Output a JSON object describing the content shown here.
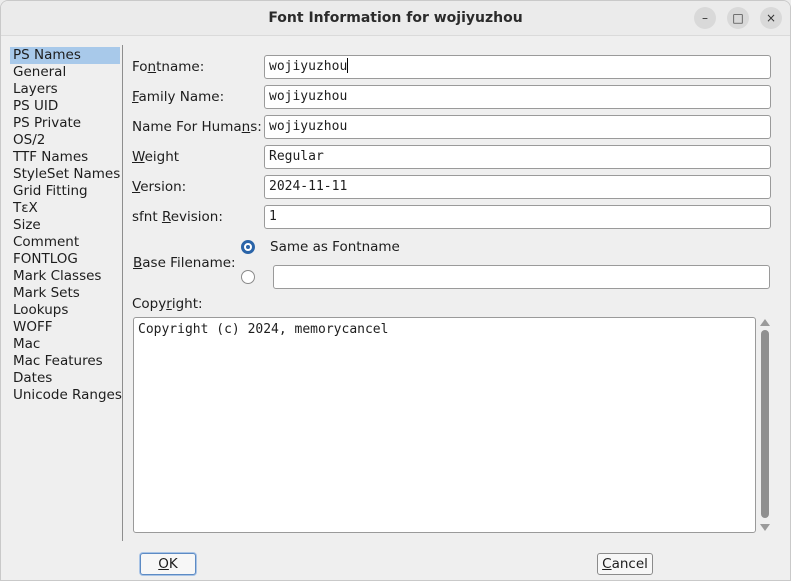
{
  "window": {
    "title": "Font Information for wojiyuzhou",
    "controls": {
      "minimize": "–",
      "maximize": "□",
      "close": "×"
    }
  },
  "sidebar": {
    "items": [
      "PS Names",
      "General",
      "Layers",
      "PS UID",
      "PS Private",
      "OS/2",
      "TTF Names",
      "StyleSet Names",
      "Grid Fitting",
      "TεX",
      "Size",
      "Comment",
      "FONTLOG",
      "Mark Classes",
      "Mark Sets",
      "Lookups",
      "WOFF",
      "Mac",
      "Mac Features",
      "Dates",
      "Unicode Ranges"
    ],
    "selected": "PS Names"
  },
  "form": {
    "fontname": {
      "label_pre": "Fo",
      "label_ul": "n",
      "label_post": "tname:",
      "value": "wojiyuzhou"
    },
    "family": {
      "label_pre": "",
      "label_ul": "F",
      "label_post": "amily Name:",
      "value": "wojiyuzhou"
    },
    "humans": {
      "label_pre": "Name For Huma",
      "label_ul": "n",
      "label_post": "s:",
      "value": "wojiyuzhou"
    },
    "weight": {
      "label_pre": "",
      "label_ul": "W",
      "label_post": "eight",
      "value": "Regular"
    },
    "version": {
      "label_pre": "",
      "label_ul": "V",
      "label_post": "ersion:",
      "value": "2024-11-11"
    },
    "sfnt": {
      "label_pre": "sfnt ",
      "label_ul": "R",
      "label_post": "evision:",
      "value": "1"
    },
    "base": {
      "label_pre": "",
      "label_ul": "B",
      "label_post": "ase Filename:",
      "option_same": "Same as Fontname",
      "selected": "same",
      "custom_value": ""
    },
    "copyright": {
      "label_pre": "Copy",
      "label_ul": "r",
      "label_post": "ight:",
      "value": "Copyright (c) 2024, memorycancel"
    }
  },
  "buttons": {
    "ok_ul": "O",
    "ok_post": "K",
    "cancel_ul": "C",
    "cancel_post": "ancel"
  }
}
